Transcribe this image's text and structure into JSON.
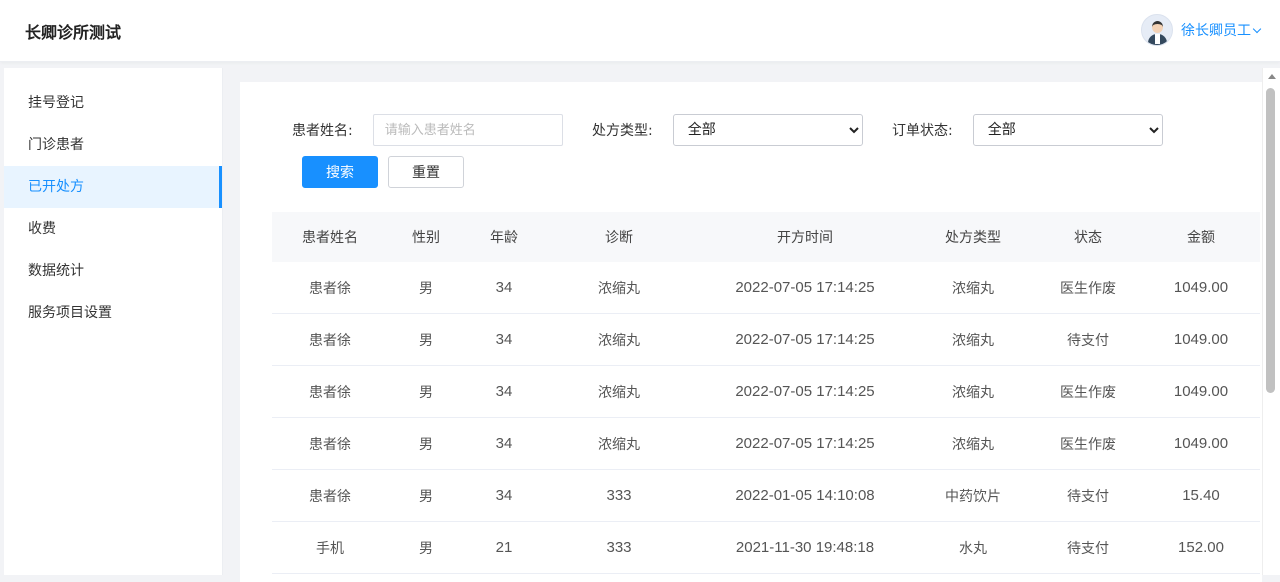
{
  "header": {
    "app_title": "长卿诊所测试",
    "user_name": "徐长卿员工"
  },
  "sidebar": {
    "items": [
      {
        "label": "挂号登记",
        "active": false
      },
      {
        "label": "门诊患者",
        "active": false
      },
      {
        "label": "已开处方",
        "active": true
      },
      {
        "label": "收费",
        "active": false
      },
      {
        "label": "数据统计",
        "active": false
      },
      {
        "label": "服务项目设置",
        "active": false
      }
    ]
  },
  "filters": {
    "patient_name_label": "患者姓名:",
    "patient_name_placeholder": "请输入患者姓名",
    "prescription_type_label": "处方类型:",
    "prescription_type_value": "全部",
    "order_status_label": "订单状态:",
    "order_status_value": "全部",
    "search_button": "搜索",
    "reset_button": "重置"
  },
  "table": {
    "columns": [
      "患者姓名",
      "性别",
      "年龄",
      "诊断",
      "开方时间",
      "处方类型",
      "状态",
      "金额"
    ],
    "rows": [
      [
        "患者徐",
        "男",
        "34",
        "浓缩丸",
        "2022-07-05 17:14:25",
        "浓缩丸",
        "医生作废",
        "1049.00"
      ],
      [
        "患者徐",
        "男",
        "34",
        "浓缩丸",
        "2022-07-05 17:14:25",
        "浓缩丸",
        "待支付",
        "1049.00"
      ],
      [
        "患者徐",
        "男",
        "34",
        "浓缩丸",
        "2022-07-05 17:14:25",
        "浓缩丸",
        "医生作废",
        "1049.00"
      ],
      [
        "患者徐",
        "男",
        "34",
        "浓缩丸",
        "2022-07-05 17:14:25",
        "浓缩丸",
        "医生作废",
        "1049.00"
      ],
      [
        "患者徐",
        "男",
        "34",
        "333",
        "2022-01-05 14:10:08",
        "中药饮片",
        "待支付",
        "15.40"
      ],
      [
        "手机",
        "男",
        "21",
        "333",
        "2021-11-30 19:48:18",
        "水丸",
        "待支付",
        "152.00"
      ]
    ]
  },
  "colors": {
    "accent": "#1890ff"
  }
}
